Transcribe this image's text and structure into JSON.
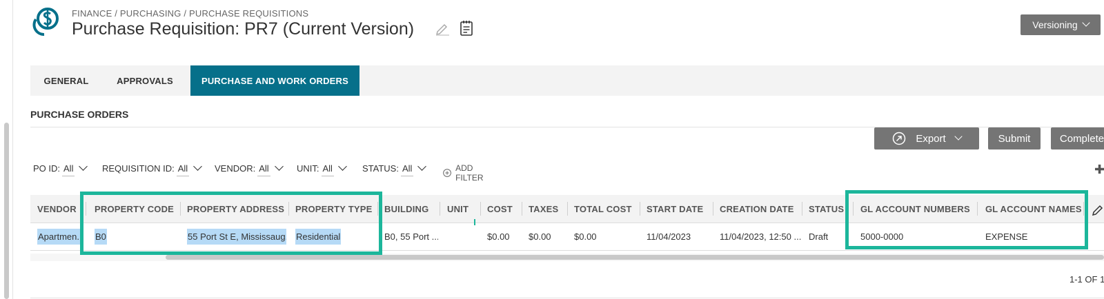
{
  "header": {
    "breadcrumb": "FINANCE / PURCHASING / PURCHASE REQUISITIONS",
    "title": "Purchase Requisition: PR7 (Current Version)",
    "versioning_label": "Versioning"
  },
  "tabs": [
    {
      "label": "GENERAL"
    },
    {
      "label": "APPROVALS"
    },
    {
      "label": "PURCHASE AND WORK ORDERS"
    }
  ],
  "section": {
    "title": "PURCHASE ORDERS"
  },
  "actions": {
    "export_label": "Export",
    "submit_label": "Submit",
    "complete_label": "Complete"
  },
  "filters": [
    {
      "label": "PO ID:",
      "value": "All"
    },
    {
      "label": "REQUISITION ID:",
      "value": "All"
    },
    {
      "label": "VENDOR:",
      "value": "All"
    },
    {
      "label": "UNIT:",
      "value": "All"
    },
    {
      "label": "STATUS:",
      "value": "All"
    }
  ],
  "add_filter_label": "ADD FILTER",
  "table": {
    "columns": [
      "VENDOR",
      "PROPERTY CODE",
      "PROPERTY ADDRESS",
      "PROPERTY TYPE",
      "BUILDING",
      "UNIT",
      "COST",
      "TAXES",
      "TOTAL COST",
      "START DATE",
      "CREATION DATE",
      "STATUS",
      "GL ACCOUNT NUMBERS",
      "GL ACCOUNT NAMES"
    ],
    "rows": [
      [
        "Apartmen...",
        "B0",
        "55 Port St E, Mississaug...",
        "Residential",
        "B0, 55 Port ...",
        "",
        "$0.00",
        "$0.00",
        "$0.00",
        "11/04/2023",
        "11/04/2023, 12:50 ...",
        "Draft",
        "5000-0000",
        "EXPENSE"
      ]
    ]
  },
  "pager": "1-1 OF 1",
  "colors": {
    "accent_tab": "#06708a",
    "highlight_frame": "#1cb69b",
    "button_gray": "#757575",
    "selection": "#b6daf6"
  },
  "icons": [
    "finance-logo-icon",
    "edit-pencil-icon",
    "notes-icon",
    "chevron-down-icon",
    "export-arrow-icon",
    "add-circle-icon",
    "gear-icon",
    "edit-columns-icon"
  ]
}
